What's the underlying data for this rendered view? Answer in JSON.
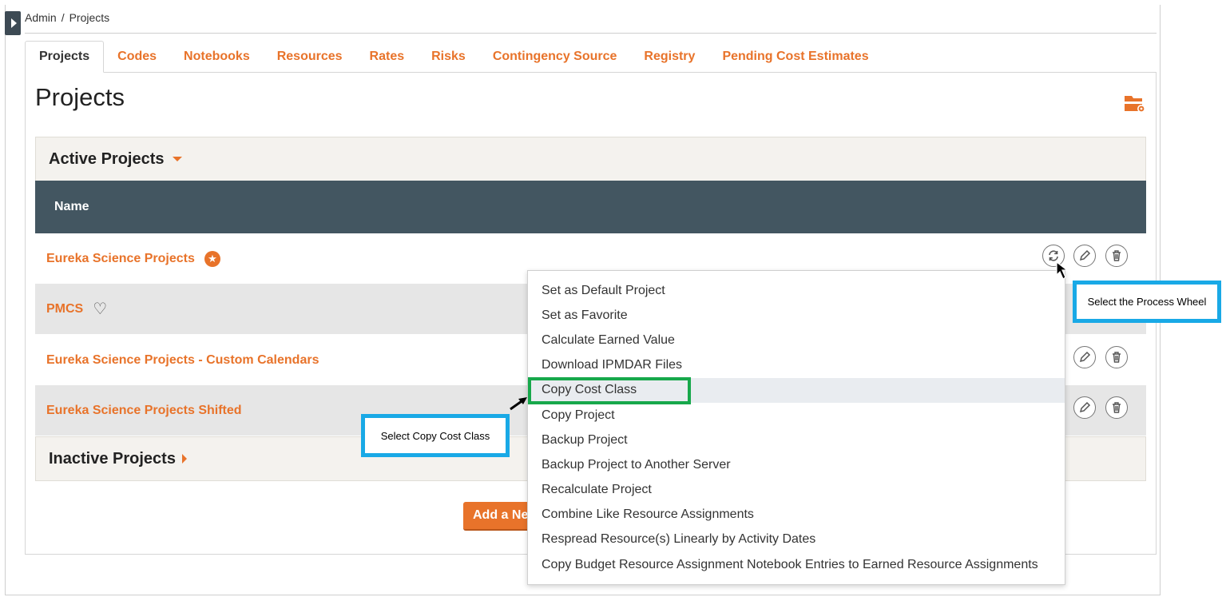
{
  "breadcrumb": {
    "root": "Admin",
    "separator": "/",
    "current": "Projects"
  },
  "tabs": [
    {
      "label": "Projects",
      "active": true
    },
    {
      "label": "Codes"
    },
    {
      "label": "Notebooks"
    },
    {
      "label": "Resources"
    },
    {
      "label": "Rates"
    },
    {
      "label": "Risks"
    },
    {
      "label": "Contingency Source"
    },
    {
      "label": "Registry"
    },
    {
      "label": "Pending Cost Estimates"
    }
  ],
  "page": {
    "title": "Projects"
  },
  "active_section": {
    "title": "Active Projects"
  },
  "table": {
    "column_name": "Name"
  },
  "projects": [
    {
      "name": "Eureka Science Projects",
      "badge": "star"
    },
    {
      "name": "PMCS",
      "badge": "heart"
    },
    {
      "name": "Eureka Science Projects - Custom Calendars"
    },
    {
      "name": "Eureka Science Projects Shifted"
    }
  ],
  "inactive_section": {
    "title": "Inactive Projects"
  },
  "add_button": {
    "label": "Add a New Project"
  },
  "process_menu": {
    "items": [
      "Set as Default Project",
      "Set as Favorite",
      "Calculate Earned Value",
      "Download IPMDAR Files",
      "Copy Cost Class",
      "Copy Project",
      "Backup Project",
      "Backup Project to Another Server",
      "Recalculate Project",
      "Combine Like Resource Assignments",
      "Respread Resource(s) Linearly by Activity Dates",
      "Copy Budget Resource Assignment Notebook Entries to Earned Resource Assignments"
    ],
    "highlighted": "Copy Cost Class"
  },
  "callouts": {
    "copy_cost_class": "Select Copy Cost Class",
    "process_wheel": "Select the Process Wheel"
  },
  "colors": {
    "accent": "#e8732a",
    "table_header": "#435661",
    "callout_border": "#19a9e6",
    "highlight_border": "#17a84b"
  }
}
